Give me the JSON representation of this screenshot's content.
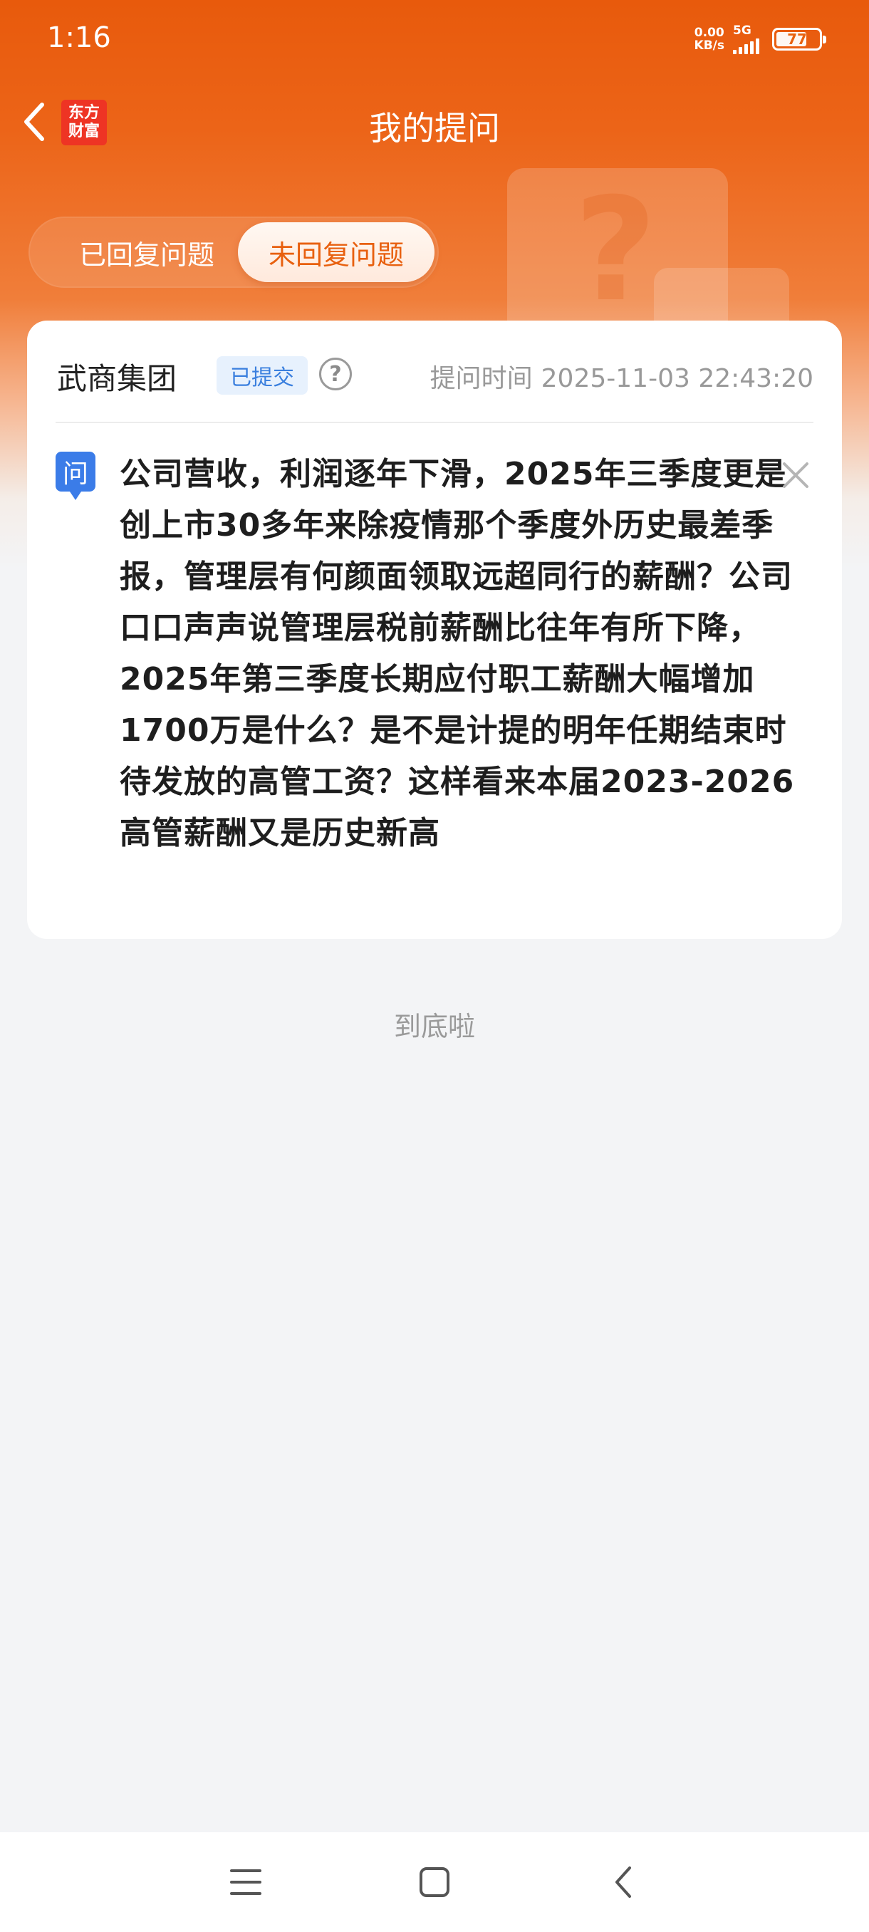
{
  "status_bar": {
    "time": "1:16",
    "net_speed_value": "0.00",
    "net_speed_unit": "KB/s",
    "network": "5G",
    "battery": "77"
  },
  "header": {
    "title": "我的提问",
    "brand_logo": [
      "东方",
      "财富"
    ]
  },
  "tabs": [
    {
      "label": "已回复问题",
      "active": false
    },
    {
      "label": "未回复问题",
      "active": true
    }
  ],
  "question_card": {
    "company": "武商集团",
    "status": "已提交",
    "time_label": "提问时间",
    "time_value": "2025-11-03 22:43:20",
    "question_badge": "问",
    "question": "公司营收，利润逐年下滑，2025年三季度更是创上市30多年来除疫情那个季度外历史最差季报，管理层有何颜面领取远超同行的薪酬？公司口口声声说管理层税前薪酬比往年有所下降，2025年第三季度长期应付职工薪酬大幅增加1700万是什么？是不是计提的明年任期结束时待发放的高管工资？这样看来本届2023-2026高管薪酬又是历史新高"
  },
  "end_text": "到底啦",
  "colors": {
    "accent_orange": "#e8600f",
    "badge_blue": "#3b7ce8"
  }
}
